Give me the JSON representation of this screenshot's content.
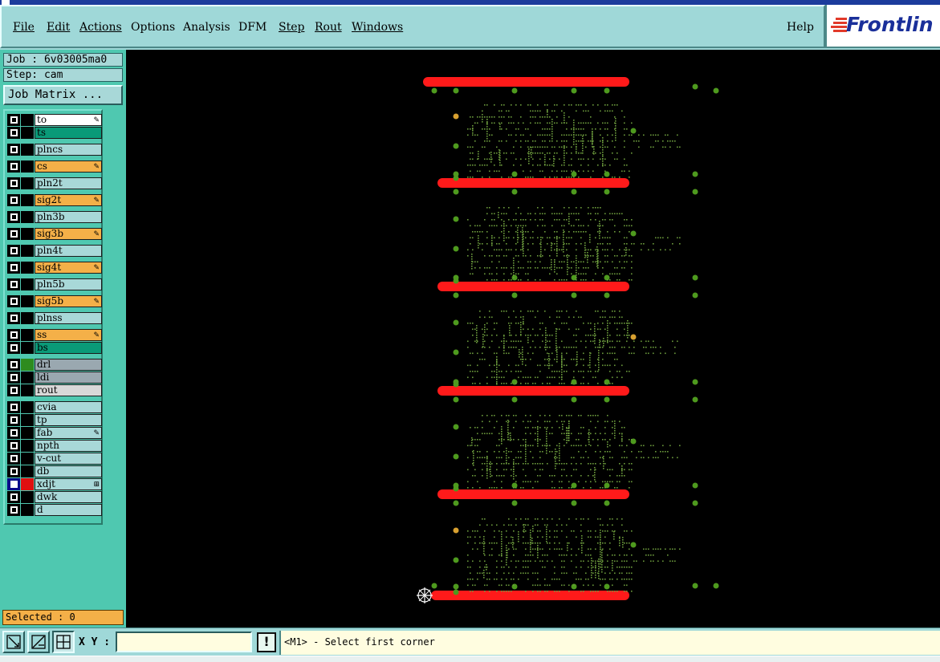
{
  "menubar": {
    "file": "File",
    "edit": "Edit",
    "actions": "Actions",
    "options": "Options",
    "analysis": "Analysis",
    "dfm": "DFM",
    "step": "Step",
    "rout": "Rout",
    "windows": "Windows",
    "help": "Help"
  },
  "logo": {
    "text": "Frontlin"
  },
  "panel": {
    "job": "Job : 6v03005ma0",
    "step": "Step: cam",
    "job_matrix": "Job Matrix ..."
  },
  "layers": [
    {
      "name": "to",
      "bg": "#ffffff",
      "mark": "pencil"
    },
    {
      "name": "ts",
      "bg": "#0a9a78"
    },
    {
      "name": "plncs",
      "bg": "#a8d8d8"
    },
    {
      "name": "cs",
      "bg": "#f4b048",
      "mark": "pencil"
    },
    {
      "name": "pln2t",
      "bg": "#a8d8d8"
    },
    {
      "name": "sig2t",
      "bg": "#f4b048",
      "mark": "pencil"
    },
    {
      "name": "pln3b",
      "bg": "#a8d8d8"
    },
    {
      "name": "sig3b",
      "bg": "#f4b048",
      "mark": "pencil"
    },
    {
      "name": "pln4t",
      "bg": "#a8d8d8"
    },
    {
      "name": "sig4t",
      "bg": "#f4b048",
      "mark": "pencil"
    },
    {
      "name": "pln5b",
      "bg": "#a8d8d8"
    },
    {
      "name": "sig5b",
      "bg": "#f4b048",
      "mark": "pencil"
    },
    {
      "name": "plnss",
      "bg": "#a8d8d8"
    },
    {
      "name": "ss",
      "bg": "#f4b048",
      "mark": "pencil"
    },
    {
      "name": "bs",
      "bg": "#0a9a78"
    },
    {
      "name": "drl",
      "bg": "#9aa8b0",
      "color": "#2e8b1e"
    },
    {
      "name": "ldi",
      "bg": "#9aa8b0"
    },
    {
      "name": "rout",
      "bg": "#d8d8d8"
    },
    {
      "name": "cvia",
      "bg": "#a8d8d8"
    },
    {
      "name": "tp",
      "bg": "#a8d8d8"
    },
    {
      "name": "fab",
      "bg": "#a8d8d8",
      "mark": "pencil"
    },
    {
      "name": "npth",
      "bg": "#a8d8d8"
    },
    {
      "name": "v-cut",
      "bg": "#a8d8d8"
    },
    {
      "name": "db",
      "bg": "#a8d8d8"
    },
    {
      "name": "xdjt",
      "bg": "#a8d8d8",
      "color": "#e01010",
      "selected": true,
      "mark": "box"
    },
    {
      "name": "dwk",
      "bg": "#a8d8d8"
    },
    {
      "name": "d",
      "bg": "#a8d8d8"
    }
  ],
  "selected": "Selected : 0",
  "bottom": {
    "xy_label": "X Y :",
    "xy_value": "",
    "exclaim": "!",
    "status": "<M1> - Select first corner"
  },
  "colors": {
    "canvas": "#000000",
    "slot": "#ff1a1a",
    "pad": "#4e9a1e",
    "trace": "#6c9a3c",
    "special_pad": "#d8a030"
  }
}
